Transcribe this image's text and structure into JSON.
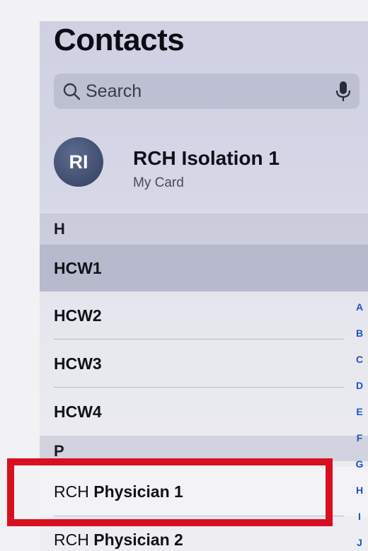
{
  "header": {
    "title": "Contacts"
  },
  "search": {
    "placeholder": "Search"
  },
  "my_card": {
    "initials": "RI",
    "name": "RCH Isolation 1",
    "subtitle": "My Card"
  },
  "sections": [
    {
      "letter": "H",
      "contacts": [
        {
          "name": "HCW1"
        },
        {
          "name": "HCW2"
        },
        {
          "name": "HCW3"
        },
        {
          "name": "HCW4"
        }
      ]
    },
    {
      "letter": "P",
      "contacts": [
        {
          "prefix": "RCH",
          "name": "Physician 1"
        },
        {
          "prefix": "RCH",
          "name": "Physician 2"
        }
      ]
    }
  ],
  "index_letters": [
    "A",
    "B",
    "C",
    "D",
    "E",
    "F",
    "G",
    "H",
    "I",
    "J"
  ],
  "colors": {
    "highlight_box": "#d80f22",
    "index_accent": "#1e53c6"
  }
}
